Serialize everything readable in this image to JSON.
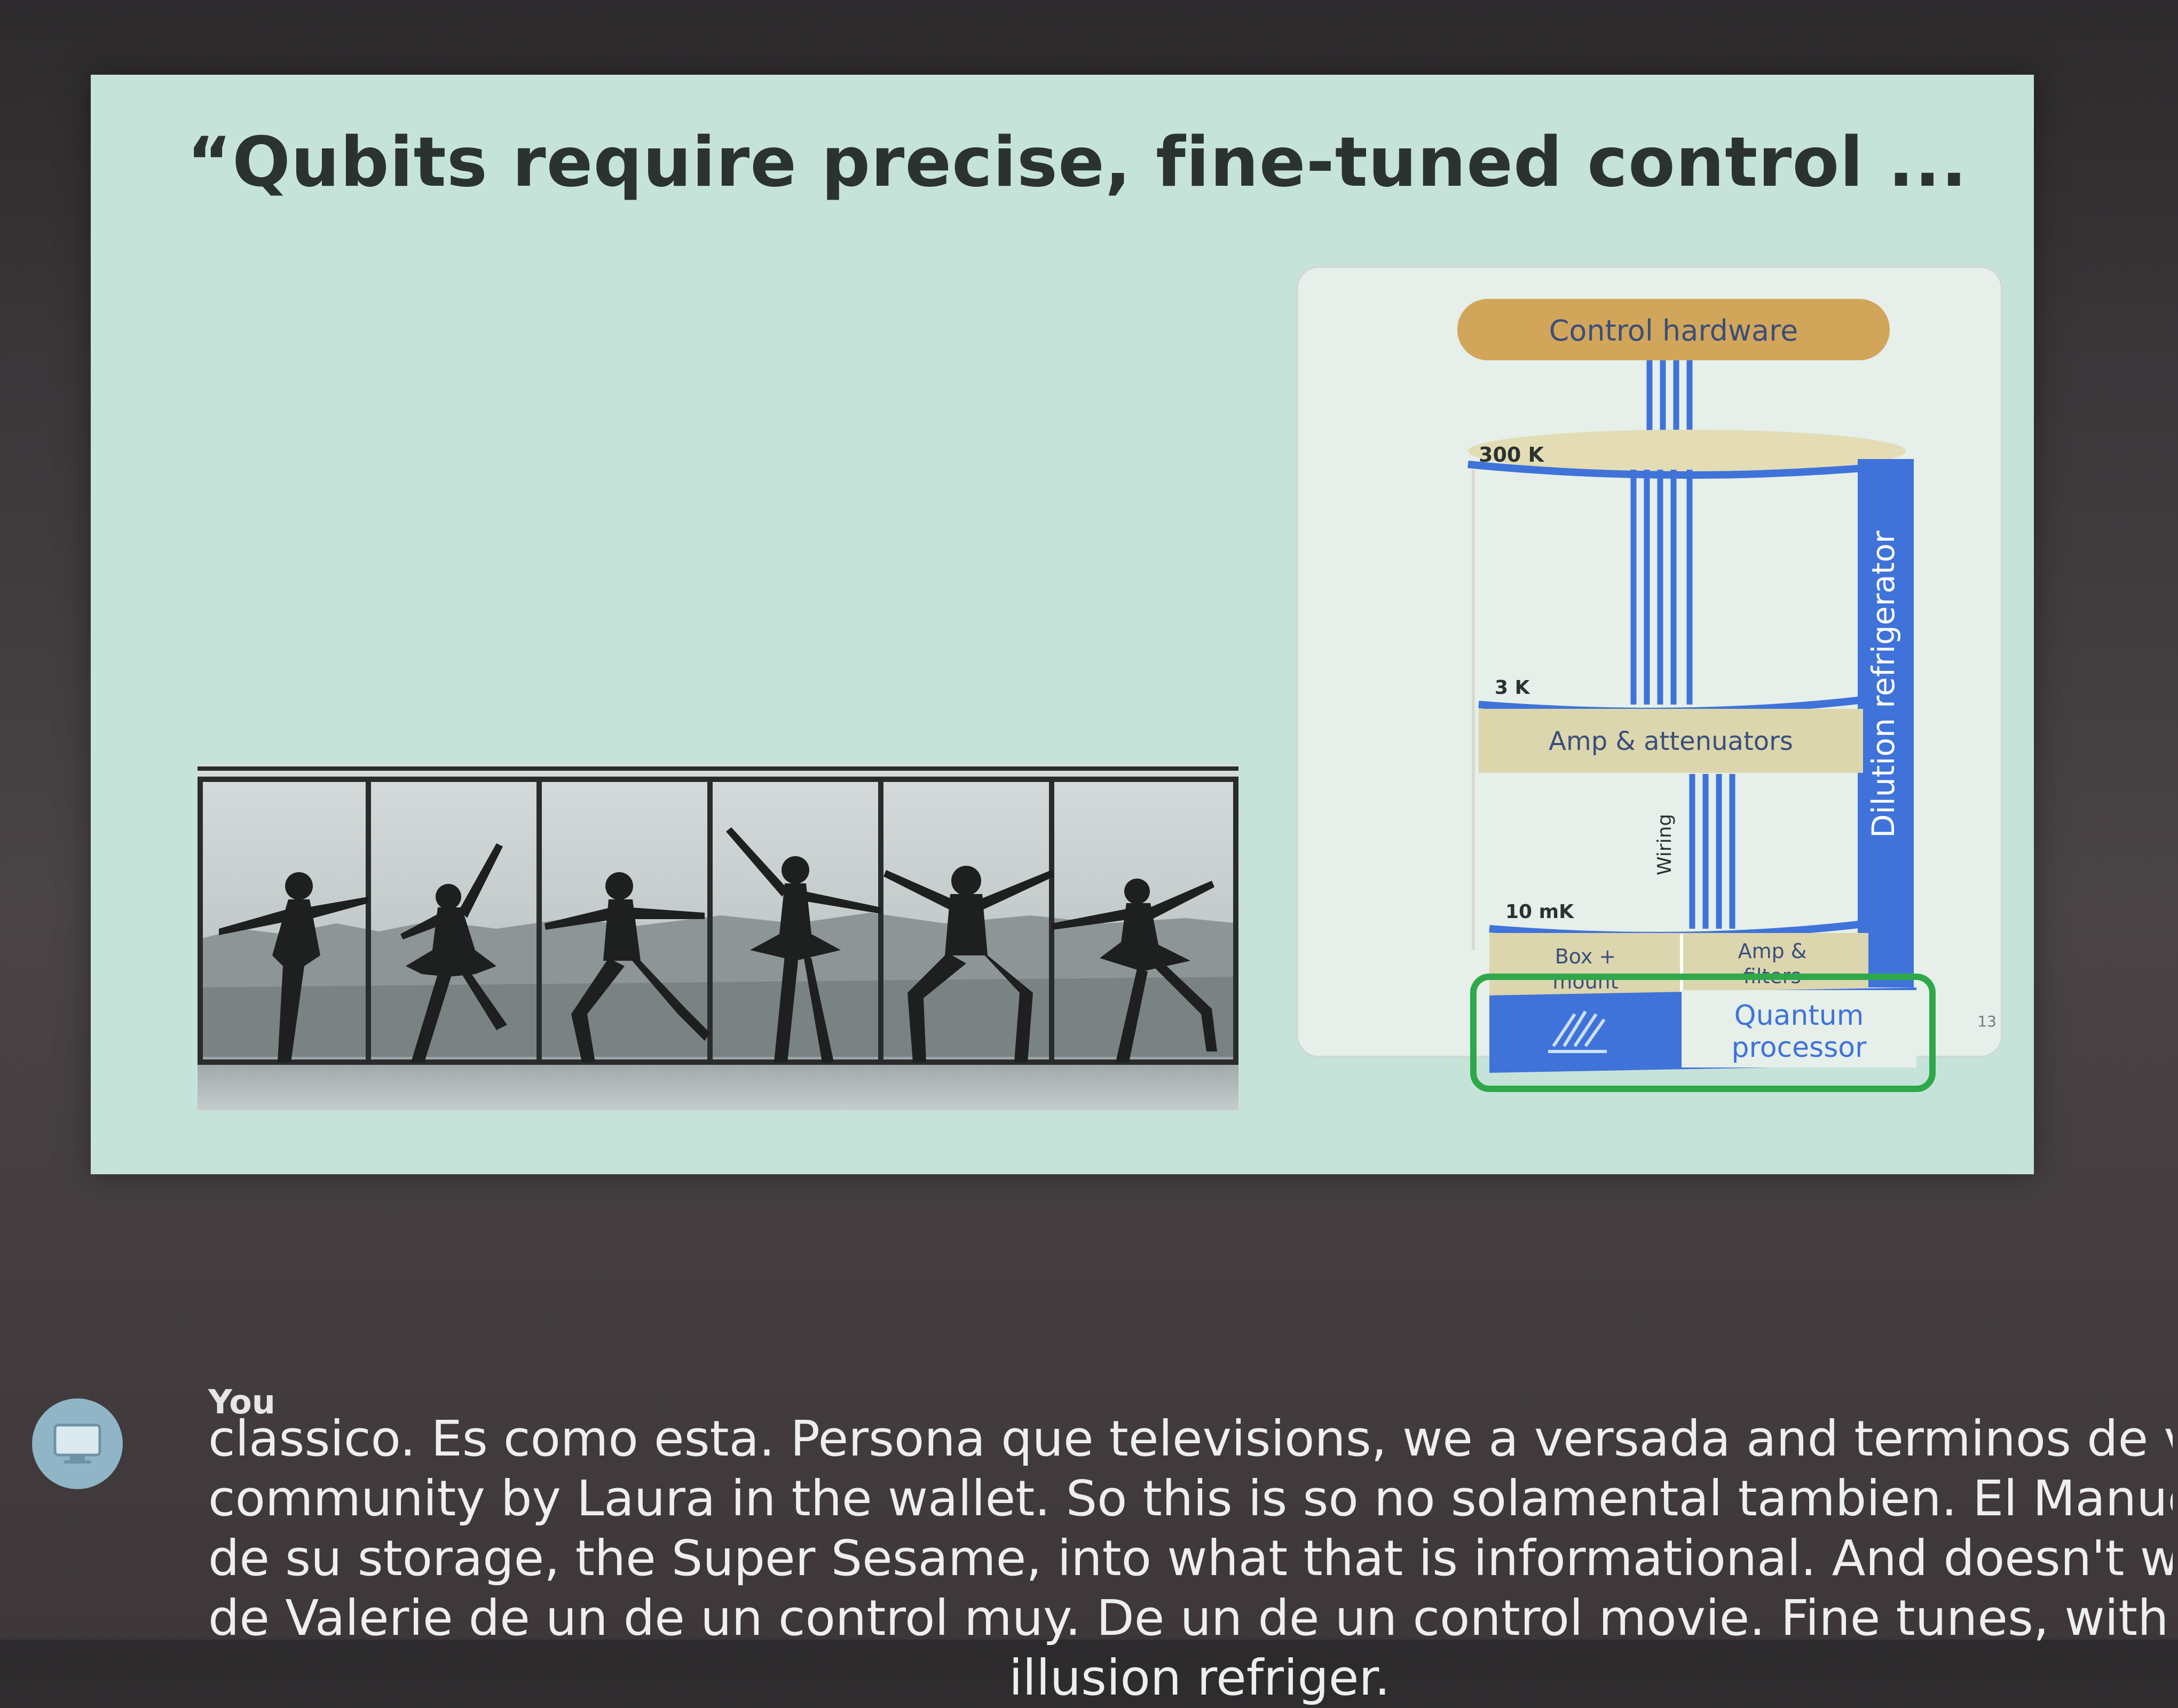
{
  "slide": {
    "title": "“Qubits require precise, fine-tuned control ...",
    "number": "13",
    "photo_icon": "ballet-dancers-window-photo",
    "diagram": {
      "control_hardware": "Control hardware",
      "temp_300k": "300 K",
      "temp_3k": "3 K",
      "temp_10mk": "10 mK",
      "amp_attenuators": "Amp & attenuators",
      "wiring": "Wiring",
      "dilution_refrigerator": "Dilution refrigerator",
      "box_mount_1": "Box +",
      "box_mount_2": "mount",
      "amp_filters_1": "Amp &",
      "amp_filters_2": "filters",
      "quantum_processor_1": "Quantum",
      "quantum_processor_2": "processor",
      "colors": {
        "gold": "#d2a65a",
        "blue": "#3f73d9",
        "green": "#2fa84a",
        "band": "#dcd6ae"
      }
    }
  },
  "caption": {
    "speaker": "You",
    "avatar_icon": "monitor-icon",
    "lines": [
      "classico. Es como esta. Persona que televisions, we a versada and terminos de vi león bitc",
      "community by Laura in the wallet. So this is so no solamental tambien. El Manuel is informa",
      "de su storage, the Super Sesame, into what that is informational. And doesn't work just by",
      "de Valerie de un de un control muy. De un de un control movie. Fine tunes, with preciso. Tu",
      "illusion refriger."
    ]
  }
}
